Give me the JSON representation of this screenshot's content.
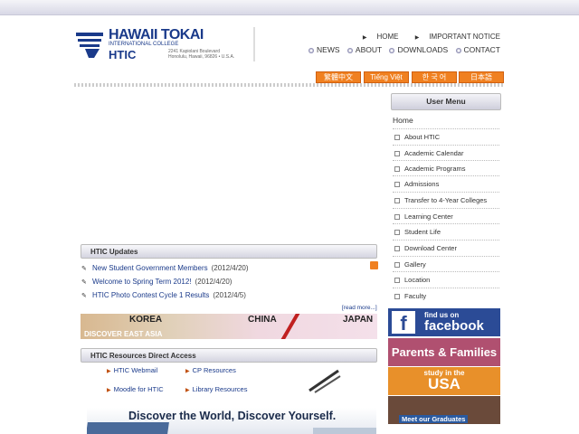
{
  "logo": {
    "name": "HAWAII TOKAI",
    "sub": "INTERNATIONAL COLLEGE",
    "abbr": "HTIC",
    "addr1": "2241 Kapiolani Boulevard",
    "addr2": "Honolulu, Hawaii, 96826 • U.S.A."
  },
  "toplinks": [
    "HOME",
    "IMPORTANT NOTICE"
  ],
  "mainnav": [
    "NEWS",
    "ABOUT",
    "DOWNLOADS",
    "CONTACT"
  ],
  "languages": [
    "繁體中文",
    "Tiếng Việt",
    "한 국 어",
    "日本語"
  ],
  "user_menu": {
    "title": "User Menu",
    "home": "Home",
    "items": [
      "About HTIC",
      "Academic Calendar",
      "Academic Programs",
      "Admissions",
      "Transfer to 4-Year Colleges",
      "Learning Center",
      "Student Life",
      "Download Center",
      "Gallery",
      "Location",
      "Faculty"
    ]
  },
  "banners": {
    "facebook_pre": "find us on",
    "facebook": "facebook",
    "parents": "Parents & Families",
    "usa_pre": "study in the",
    "usa": "USA",
    "grads": "Meet our Graduates"
  },
  "updates": {
    "title": "HTIC Updates",
    "items": [
      {
        "title": "New Student Government Members",
        "date": "(2012/4/20)"
      },
      {
        "title": "Welcome to Spring Term 2012!",
        "date": "(2012/4/20)"
      },
      {
        "title": "HTIC Photo Contest Cycle 1 Results",
        "date": "(2012/4/5)"
      }
    ],
    "read_more": "[read more...]"
  },
  "east_asia": {
    "countries": [
      "KOREA",
      "CHINA",
      "JAPAN"
    ],
    "tagline": "DISCOVER EAST ASIA"
  },
  "resources": {
    "title": "HTIC Resources Direct Access",
    "links": [
      "HTIC Webmail",
      "CP Resources",
      "Moodle for HTIC",
      "Library Resources"
    ]
  },
  "discover": "Discover the World, Discover Yourself."
}
